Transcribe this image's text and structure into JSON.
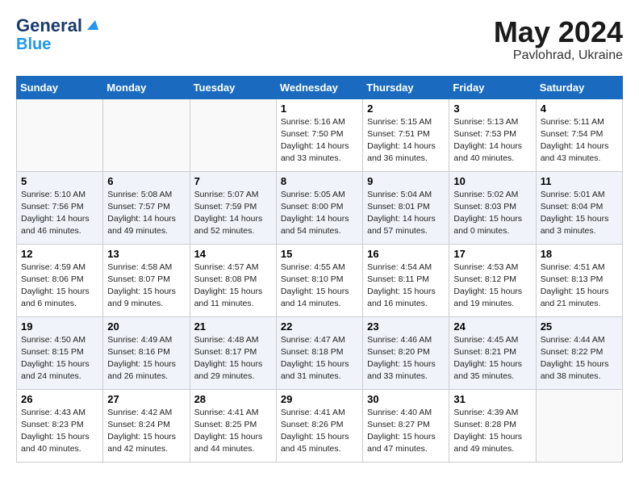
{
  "header": {
    "logo_line1": "General",
    "logo_line2": "Blue",
    "month": "May 2024",
    "location": "Pavlohrad, Ukraine"
  },
  "weekdays": [
    "Sunday",
    "Monday",
    "Tuesday",
    "Wednesday",
    "Thursday",
    "Friday",
    "Saturday"
  ],
  "weeks": [
    [
      {
        "day": "",
        "info": ""
      },
      {
        "day": "",
        "info": ""
      },
      {
        "day": "",
        "info": ""
      },
      {
        "day": "1",
        "info": "Sunrise: 5:16 AM\nSunset: 7:50 PM\nDaylight: 14 hours\nand 33 minutes."
      },
      {
        "day": "2",
        "info": "Sunrise: 5:15 AM\nSunset: 7:51 PM\nDaylight: 14 hours\nand 36 minutes."
      },
      {
        "day": "3",
        "info": "Sunrise: 5:13 AM\nSunset: 7:53 PM\nDaylight: 14 hours\nand 40 minutes."
      },
      {
        "day": "4",
        "info": "Sunrise: 5:11 AM\nSunset: 7:54 PM\nDaylight: 14 hours\nand 43 minutes."
      }
    ],
    [
      {
        "day": "5",
        "info": "Sunrise: 5:10 AM\nSunset: 7:56 PM\nDaylight: 14 hours\nand 46 minutes."
      },
      {
        "day": "6",
        "info": "Sunrise: 5:08 AM\nSunset: 7:57 PM\nDaylight: 14 hours\nand 49 minutes."
      },
      {
        "day": "7",
        "info": "Sunrise: 5:07 AM\nSunset: 7:59 PM\nDaylight: 14 hours\nand 52 minutes."
      },
      {
        "day": "8",
        "info": "Sunrise: 5:05 AM\nSunset: 8:00 PM\nDaylight: 14 hours\nand 54 minutes."
      },
      {
        "day": "9",
        "info": "Sunrise: 5:04 AM\nSunset: 8:01 PM\nDaylight: 14 hours\nand 57 minutes."
      },
      {
        "day": "10",
        "info": "Sunrise: 5:02 AM\nSunset: 8:03 PM\nDaylight: 15 hours\nand 0 minutes."
      },
      {
        "day": "11",
        "info": "Sunrise: 5:01 AM\nSunset: 8:04 PM\nDaylight: 15 hours\nand 3 minutes."
      }
    ],
    [
      {
        "day": "12",
        "info": "Sunrise: 4:59 AM\nSunset: 8:06 PM\nDaylight: 15 hours\nand 6 minutes."
      },
      {
        "day": "13",
        "info": "Sunrise: 4:58 AM\nSunset: 8:07 PM\nDaylight: 15 hours\nand 9 minutes."
      },
      {
        "day": "14",
        "info": "Sunrise: 4:57 AM\nSunset: 8:08 PM\nDaylight: 15 hours\nand 11 minutes."
      },
      {
        "day": "15",
        "info": "Sunrise: 4:55 AM\nSunset: 8:10 PM\nDaylight: 15 hours\nand 14 minutes."
      },
      {
        "day": "16",
        "info": "Sunrise: 4:54 AM\nSunset: 8:11 PM\nDaylight: 15 hours\nand 16 minutes."
      },
      {
        "day": "17",
        "info": "Sunrise: 4:53 AM\nSunset: 8:12 PM\nDaylight: 15 hours\nand 19 minutes."
      },
      {
        "day": "18",
        "info": "Sunrise: 4:51 AM\nSunset: 8:13 PM\nDaylight: 15 hours\nand 21 minutes."
      }
    ],
    [
      {
        "day": "19",
        "info": "Sunrise: 4:50 AM\nSunset: 8:15 PM\nDaylight: 15 hours\nand 24 minutes."
      },
      {
        "day": "20",
        "info": "Sunrise: 4:49 AM\nSunset: 8:16 PM\nDaylight: 15 hours\nand 26 minutes."
      },
      {
        "day": "21",
        "info": "Sunrise: 4:48 AM\nSunset: 8:17 PM\nDaylight: 15 hours\nand 29 minutes."
      },
      {
        "day": "22",
        "info": "Sunrise: 4:47 AM\nSunset: 8:18 PM\nDaylight: 15 hours\nand 31 minutes."
      },
      {
        "day": "23",
        "info": "Sunrise: 4:46 AM\nSunset: 8:20 PM\nDaylight: 15 hours\nand 33 minutes."
      },
      {
        "day": "24",
        "info": "Sunrise: 4:45 AM\nSunset: 8:21 PM\nDaylight: 15 hours\nand 35 minutes."
      },
      {
        "day": "25",
        "info": "Sunrise: 4:44 AM\nSunset: 8:22 PM\nDaylight: 15 hours\nand 38 minutes."
      }
    ],
    [
      {
        "day": "26",
        "info": "Sunrise: 4:43 AM\nSunset: 8:23 PM\nDaylight: 15 hours\nand 40 minutes."
      },
      {
        "day": "27",
        "info": "Sunrise: 4:42 AM\nSunset: 8:24 PM\nDaylight: 15 hours\nand 42 minutes."
      },
      {
        "day": "28",
        "info": "Sunrise: 4:41 AM\nSunset: 8:25 PM\nDaylight: 15 hours\nand 44 minutes."
      },
      {
        "day": "29",
        "info": "Sunrise: 4:41 AM\nSunset: 8:26 PM\nDaylight: 15 hours\nand 45 minutes."
      },
      {
        "day": "30",
        "info": "Sunrise: 4:40 AM\nSunset: 8:27 PM\nDaylight: 15 hours\nand 47 minutes."
      },
      {
        "day": "31",
        "info": "Sunrise: 4:39 AM\nSunset: 8:28 PM\nDaylight: 15 hours\nand 49 minutes."
      },
      {
        "day": "",
        "info": ""
      }
    ]
  ]
}
